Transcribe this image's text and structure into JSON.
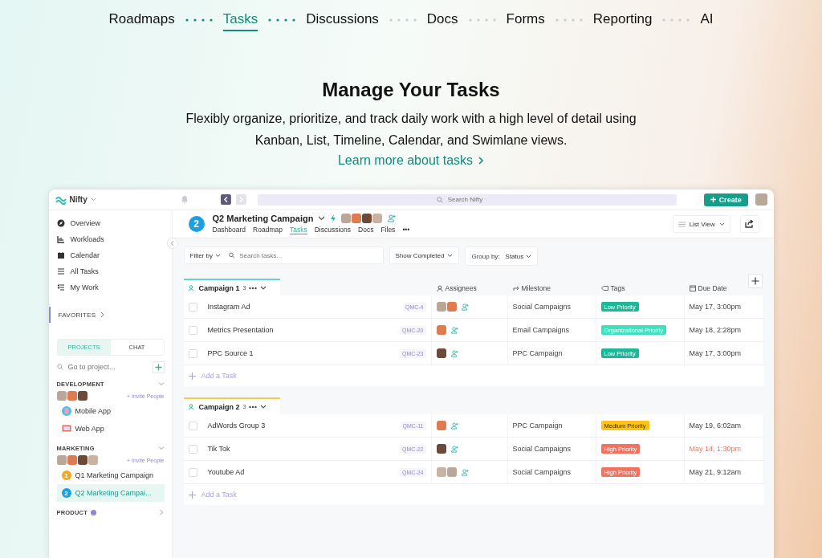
{
  "nav": {
    "tabs": [
      {
        "label": "Roadmaps",
        "selected": false
      },
      {
        "label": "Tasks",
        "selected": true
      },
      {
        "label": "Discussions",
        "selected": false
      },
      {
        "label": "Docs",
        "selected": false
      },
      {
        "label": "Forms",
        "selected": false
      },
      {
        "label": "Reporting",
        "selected": false
      },
      {
        "label": "AI",
        "selected": false
      }
    ]
  },
  "hero": {
    "title": "Manage Your Tasks",
    "subtitle_lines": [
      "Flexibly organize, prioritize, and track daily work with a high level of detail using",
      "Kanban, List, Timeline, Calendar, and Swimlane views."
    ],
    "link": "Learn more about tasks"
  },
  "app": {
    "brand": "Nifty",
    "search_placeholder": "Search Nifty",
    "create": "Create",
    "sidebar": {
      "items": [
        {
          "label": "Overview",
          "kind": "overview"
        },
        {
          "label": "Workloads",
          "kind": "workloads"
        },
        {
          "label": "Calendar",
          "kind": "calendar"
        },
        {
          "label": "All Tasks",
          "kind": "list"
        },
        {
          "label": "My Work",
          "kind": "checklist"
        }
      ],
      "favorites": "FAVORITES",
      "tabs": [
        {
          "label": "PROJECTS",
          "selected": true
        },
        {
          "label": "CHAT",
          "selected": false
        }
      ],
      "goto_placeholder": "Go to project...",
      "groups": [
        {
          "name": "DEVELOPMENT",
          "expanded": true,
          "help": false,
          "members": [
            {
              "kind": "photo"
            },
            {
              "kind": "photo"
            },
            {
              "kind": "photo"
            }
          ],
          "invite": "+ Invite People",
          "projects": [
            {
              "name": "Mobile App",
              "kind": "mobile",
              "selected": false
            },
            {
              "name": "Web App",
              "kind": "web",
              "selected": false
            }
          ]
        },
        {
          "name": "MARKETING",
          "expanded": true,
          "help": false,
          "members": [
            {
              "kind": "photo"
            },
            {
              "kind": "photo"
            },
            {
              "kind": "photo"
            },
            {
              "kind": "photo"
            }
          ],
          "invite": "+ Invite People",
          "projects": [
            {
              "name": "Q1 Marketing Campaign",
              "kind": "number",
              "badge": "1",
              "color": "#f5a623",
              "selected": false
            },
            {
              "name": "Q2 Marketing Campai...",
              "kind": "number",
              "badge": "2",
              "color": "#1ba1e2",
              "selected": true
            }
          ]
        },
        {
          "name": "PRODUCT",
          "expanded": false,
          "help": true
        }
      ]
    }
  },
  "project": {
    "badge": "2",
    "title": "Q2 Marketing Campaign",
    "members": [
      {
        "kind": "photo"
      },
      {
        "kind": "photo"
      },
      {
        "kind": "photo"
      },
      {
        "kind": "photo"
      }
    ],
    "tabs": [
      {
        "label": "Dashboard",
        "selected": false
      },
      {
        "label": "Roadmap",
        "selected": false
      },
      {
        "label": "Tasks",
        "selected": true
      },
      {
        "label": "Discussions",
        "selected": false
      },
      {
        "label": "Docs",
        "selected": false
      },
      {
        "label": "Files",
        "selected": false
      }
    ],
    "more": "•••",
    "view": "List View"
  },
  "toolbar": {
    "filter": "Filter by",
    "search_placeholder": "Search tasks...",
    "show_completed": "Show Completed",
    "group_label": "Group by:",
    "group_value": "Status"
  },
  "columns": [
    "Assignees",
    "Milestone",
    "Tags",
    "Due Date"
  ],
  "groups": [
    {
      "name": "Campaign 1",
      "count": "3",
      "color": "#5fd4d8",
      "add": "Add a Task",
      "rows": [
        {
          "checked": false,
          "name": "Instagram Ad",
          "code": "QMC-4",
          "assignees": [
            {
              "kind": "photo"
            },
            {
              "kind": "photo"
            }
          ],
          "milestone": "Social Campaigns",
          "tag": {
            "label": "Low Priority",
            "color": "#1bb89a"
          },
          "due": "May 17, 3:00pm",
          "overdue": false
        },
        {
          "checked": false,
          "name": "Metrics Presentation",
          "code": "QMC-20",
          "assignees": [
            {
              "kind": "photo"
            }
          ],
          "milestone": "Email Campaigns",
          "tag": {
            "label": "Organizational Priority",
            "color": "#3ee0c0"
          },
          "due": "May 18, 2:28pm",
          "overdue": false
        },
        {
          "checked": false,
          "name": "PPC Source 1",
          "code": "QMC-23",
          "assignees": [
            {
              "kind": "photo"
            }
          ],
          "milestone": "PPC Campaign",
          "tag": {
            "label": "Low Priority",
            "color": "#1bb89a"
          },
          "due": "May 17, 3:00pm",
          "overdue": false
        }
      ]
    },
    {
      "name": "Campaign 2",
      "count": "3",
      "color": "#f7c948",
      "add": "Add a Task",
      "rows": [
        {
          "checked": false,
          "name": "AdWords Group 3",
          "code": "QMC-11",
          "assignees": [
            {
              "kind": "photo"
            }
          ],
          "milestone": "PPC Campaign",
          "tag": {
            "label": "Medium Priority",
            "color": "#fcc419"
          },
          "due": "May 19, 6:02am",
          "overdue": false
        },
        {
          "checked": false,
          "name": "Tik Tok",
          "code": "QMC-22",
          "assignees": [
            {
              "kind": "photo"
            }
          ],
          "milestone": "Social Campaigns",
          "tag": {
            "label": "High Priority",
            "color": "#f4715e"
          },
          "due": "May 14, 1:30pm",
          "overdue": true
        },
        {
          "checked": false,
          "name": "Youtube Ad",
          "code": "QMC-24",
          "assignees": [
            {
              "kind": "photo"
            },
            {
              "kind": "photo"
            }
          ],
          "milestone": "Social Campaigns",
          "tag": {
            "label": "High Priority",
            "color": "#f4715e"
          },
          "due": "May 21, 9:12am",
          "overdue": false
        }
      ]
    }
  ]
}
